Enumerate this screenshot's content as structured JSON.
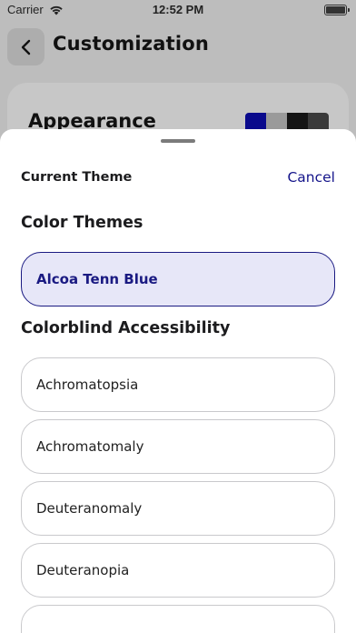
{
  "status_bar": {
    "carrier": "Carrier",
    "time": "12:52 PM"
  },
  "header": {
    "title": "Customization"
  },
  "background_card": {
    "title": "Appearance",
    "swatch_colors": [
      "#0a0a8c",
      "#9a9a9a",
      "#141414",
      "#3a3a3a"
    ]
  },
  "sheet": {
    "current_theme_label": "Current Theme",
    "cancel_label": "Cancel",
    "color_themes_heading": "Color Themes",
    "color_themes": [
      {
        "label": "Alcoa Tenn Blue",
        "selected": true
      }
    ],
    "colorblind_heading": "Colorblind Accessibility",
    "colorblind_options": [
      {
        "label": "Achromatopsia"
      },
      {
        "label": "Achromatomaly"
      },
      {
        "label": "Deuteranomaly"
      },
      {
        "label": "Deuteranopia"
      }
    ]
  },
  "colors": {
    "accent": "#14148a",
    "selected_bg": "#e7e7f8"
  }
}
